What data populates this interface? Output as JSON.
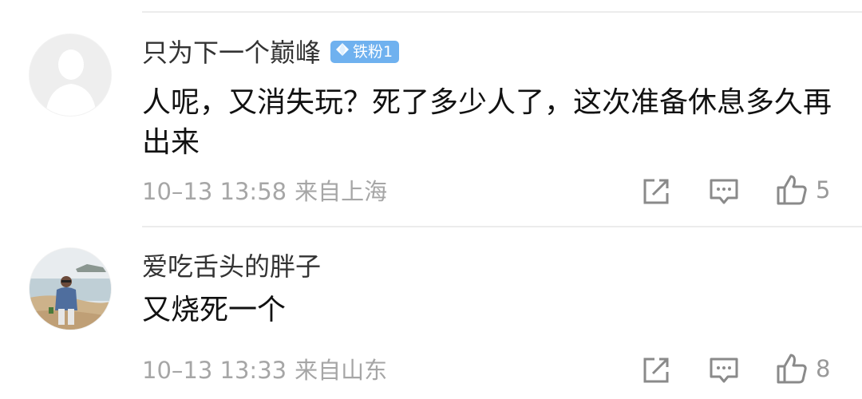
{
  "comments": [
    {
      "username": "只为下一个巅峰",
      "badge": "铁粉1",
      "text": "人呢，又消失玩？死了多少人了，这次准备休息多久再出来",
      "time": "10–13 13:58",
      "location": "来自上海",
      "likes": "5"
    },
    {
      "username": "爱吃舌头的胖子",
      "text": "又烧死一个",
      "time": "10–13 13:33",
      "location": "来自山东",
      "likes": "8"
    }
  ],
  "colors": {
    "badge": "#6fb1ef",
    "meta": "#a6a6a6",
    "icon": "#8a8a8a"
  },
  "icons": [
    "share-icon",
    "comment-icon",
    "thumbs-up-icon",
    "diamond-icon"
  ]
}
